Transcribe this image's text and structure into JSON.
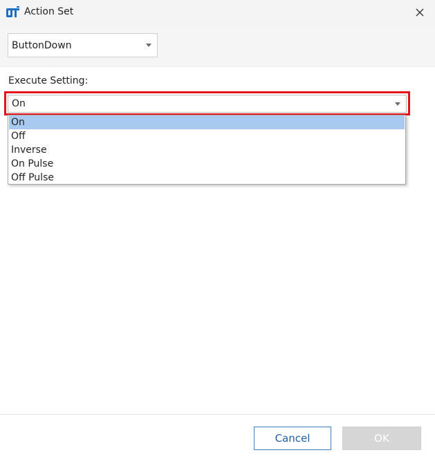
{
  "window": {
    "title": "Action Set",
    "icon_name": "app-logo-icon",
    "close_icon": "close-icon"
  },
  "event": {
    "selected": "ButtonDown"
  },
  "execute": {
    "label": "Execute Setting:",
    "selected": "On",
    "options": [
      "On",
      "Off",
      "Inverse",
      "On Pulse",
      "Off Pulse"
    ],
    "highlight_color": "#e8101a",
    "selection_color": "#a8caf0"
  },
  "footer": {
    "cancel_label": "Cancel",
    "ok_label": "OK"
  }
}
